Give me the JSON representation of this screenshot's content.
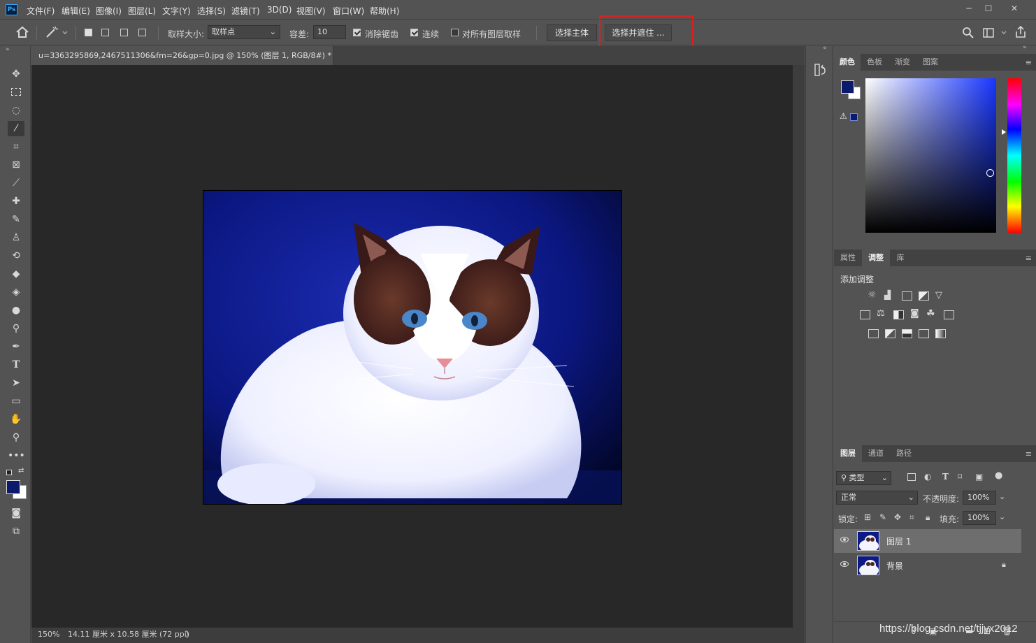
{
  "app": {
    "logo": "Ps",
    "menu": [
      "文件(F)",
      "编辑(E)",
      "图像(I)",
      "图层(L)",
      "文字(Y)",
      "选择(S)",
      "滤镜(T)",
      "3D(D)",
      "视图(V)",
      "窗口(W)",
      "帮助(H)"
    ],
    "window_controls": [
      "─",
      "☐",
      "✕"
    ]
  },
  "options": {
    "sample_size_label": "取样大小:",
    "sample_size_value": "取样点",
    "tolerance_label": "容差:",
    "tolerance_value": "10",
    "antialias_label": "消除锯齿",
    "antialias_checked": true,
    "contiguous_label": "连续",
    "contiguous_checked": true,
    "all_layers_label": "对所有图层取样",
    "all_layers_checked": false,
    "select_subject_label": "选择主体",
    "select_and_mask_label": "选择并遮住 ...",
    "highlight_color": "#e01e1e"
  },
  "document": {
    "tab_title": "u=3363295869,2467511306&fm=26&gp=0.jpg @ 150% (图层 1, RGB/8#) *",
    "tab_close": "×",
    "zoom": "150%",
    "doc_size": "14.11 厘米 x 10.58 厘米 (72 ppi)",
    "status_arrow": "〉"
  },
  "color_panel": {
    "tabs": [
      "颜色",
      "色板",
      "渐变",
      "图案"
    ],
    "active_tab": "颜色",
    "foreground": "#0c1a6e",
    "background": "#ffffff"
  },
  "adjust_panel": {
    "tabs": [
      "属性",
      "调整",
      "库"
    ],
    "active_tab": "调整",
    "title": "添加调整"
  },
  "layers_panel": {
    "tabs": [
      "图层",
      "通道",
      "路径"
    ],
    "active_tab": "图层",
    "filter_kind": "类型",
    "blend_mode": "正常",
    "opacity_label": "不透明度:",
    "opacity_value": "100%",
    "lock_label": "锁定:",
    "fill_label": "填充:",
    "fill_value": "100%",
    "layers": [
      {
        "name": "图层 1",
        "selected": true,
        "locked": false
      },
      {
        "name": "背景",
        "selected": false,
        "locked": true
      }
    ]
  },
  "watermark": "https://blog.csdn.net/tjjyx2012"
}
